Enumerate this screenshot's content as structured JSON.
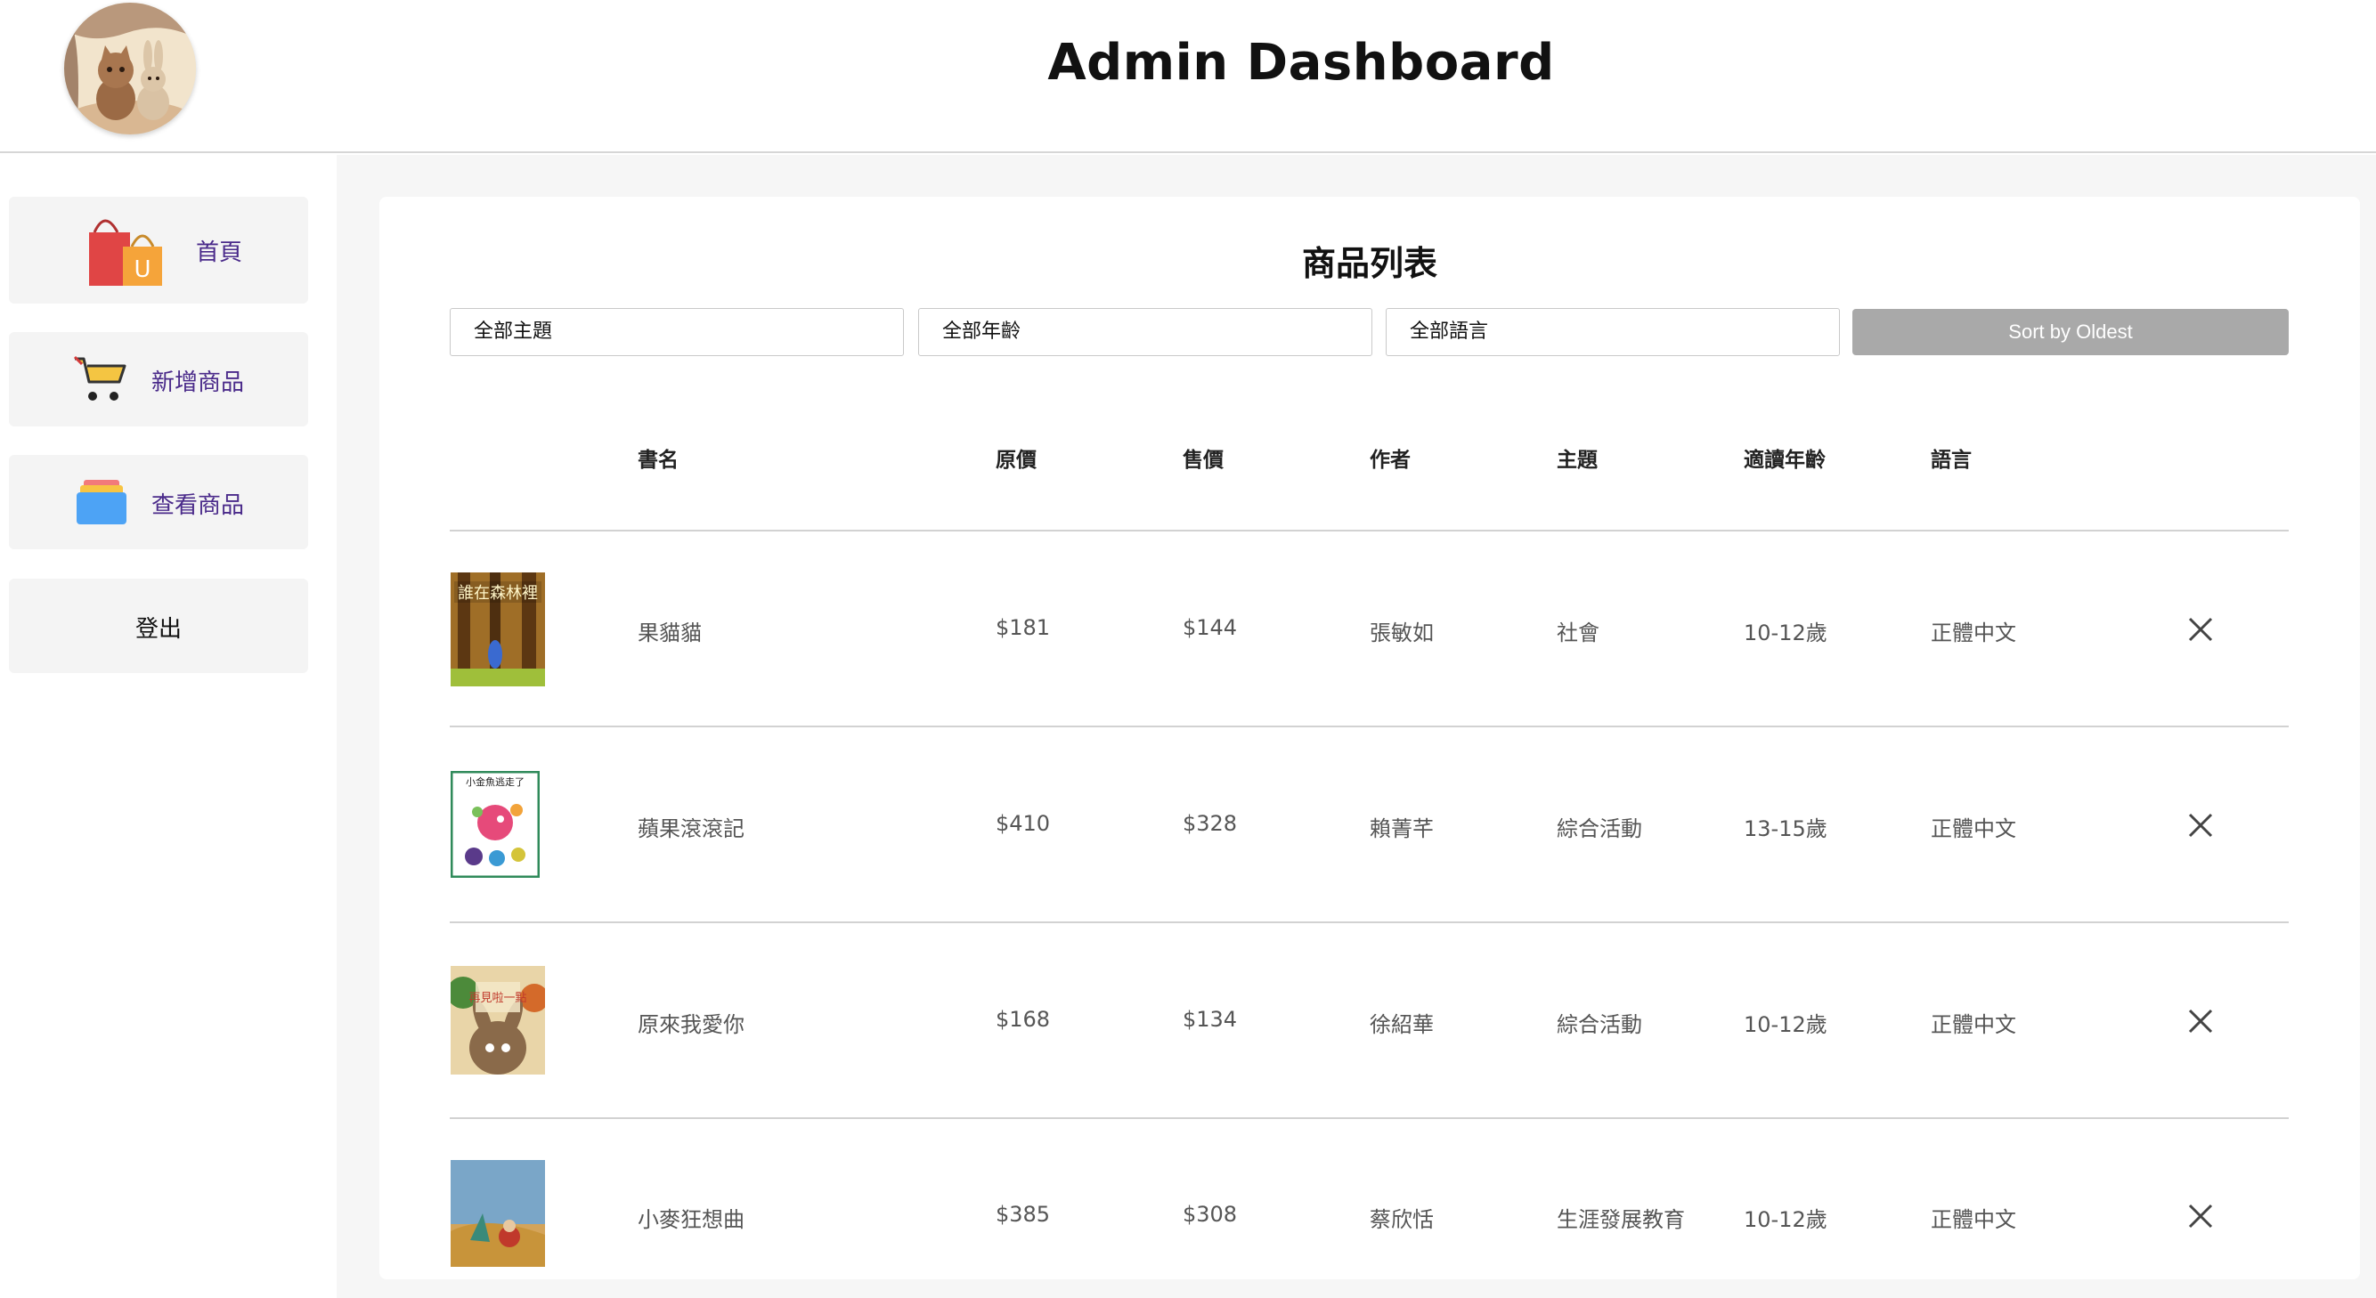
{
  "header": {
    "title": "Admin Dashboard"
  },
  "sidebar": {
    "items": [
      {
        "label": "首頁",
        "icon": "shopping-bag-icon"
      },
      {
        "label": "新增商品",
        "icon": "cart-icon"
      },
      {
        "label": "查看商品",
        "icon": "stack-icon"
      },
      {
        "label": "登出"
      }
    ]
  },
  "panel": {
    "title": "商品列表",
    "filters": {
      "topic": "全部主題",
      "age": "全部年齡",
      "language": "全部語言"
    },
    "sort_label": "Sort by Oldest"
  },
  "table": {
    "columns": [
      "書名",
      "原價",
      "售價",
      "作者",
      "主題",
      "適讀年齡",
      "語言"
    ],
    "rows": [
      {
        "cover_text": "誰在森林裡",
        "title": "果貓貓",
        "price": "$181",
        "sale": "$144",
        "author": "張敏如",
        "topic": "社會",
        "age": "10-12歲",
        "language": "正體中文"
      },
      {
        "cover_text": "小金魚逃走了",
        "title": "蘋果滾滾記",
        "price": "$410",
        "sale": "$328",
        "author": "賴菁芊",
        "topic": "綜合活動",
        "age": "13-15歲",
        "language": "正體中文"
      },
      {
        "cover_text": "再見啦一點",
        "title": "原來我愛你",
        "price": "$168",
        "sale": "$134",
        "author": "徐紹華",
        "topic": "綜合活動",
        "age": "10-12歲",
        "language": "正體中文"
      },
      {
        "cover_text": "",
        "title": "小麥狂想曲",
        "price": "$385",
        "sale": "$308",
        "author": "蔡欣恬",
        "topic": "生涯發展教育",
        "age": "10-12歲",
        "language": "正體中文"
      }
    ]
  },
  "colors": {
    "nav_text": "#4a2a8a",
    "sort_button": "#a9a9a9",
    "panel_bg": "#f6f6f6"
  }
}
